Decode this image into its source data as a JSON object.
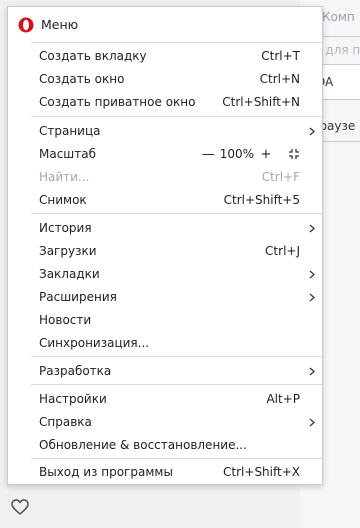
{
  "background": {
    "tab_fragment": "Комп",
    "search_fragment": "с для п",
    "input_fragment": "DA",
    "side_fragment": "браузе"
  },
  "menu": {
    "title": "Меню",
    "logo_icon": "opera-logo",
    "accent": "#d3131c",
    "groups": {
      "create_tab": {
        "label": "Создать вкладку",
        "shortcut": "Ctrl+T"
      },
      "create_window": {
        "label": "Создать окно",
        "shortcut": "Ctrl+N"
      },
      "create_private": {
        "label": "Создать приватное окно",
        "shortcut": "Ctrl+Shift+N"
      },
      "page": {
        "label": "Страница"
      },
      "zoom": {
        "label": "Масштаб",
        "minus": "—",
        "value": "100%",
        "plus": "+"
      },
      "find": {
        "label": "Найти...",
        "shortcut": "Ctrl+F"
      },
      "snapshot": {
        "label": "Снимок",
        "shortcut": "Ctrl+Shift+5"
      },
      "history": {
        "label": "История"
      },
      "downloads": {
        "label": "Загрузки",
        "shortcut": "Ctrl+J"
      },
      "bookmarks": {
        "label": "Закладки"
      },
      "extensions": {
        "label": "Расширения"
      },
      "news": {
        "label": "Новости"
      },
      "sync": {
        "label": "Синхронизация..."
      },
      "developer": {
        "label": "Разработка"
      },
      "settings": {
        "label": "Настройки",
        "shortcut": "Alt+P"
      },
      "help": {
        "label": "Справка"
      },
      "update": {
        "label": "Обновление & восстановление..."
      },
      "exit": {
        "label": "Выход из программы",
        "shortcut": "Ctrl+Shift+X"
      }
    }
  }
}
